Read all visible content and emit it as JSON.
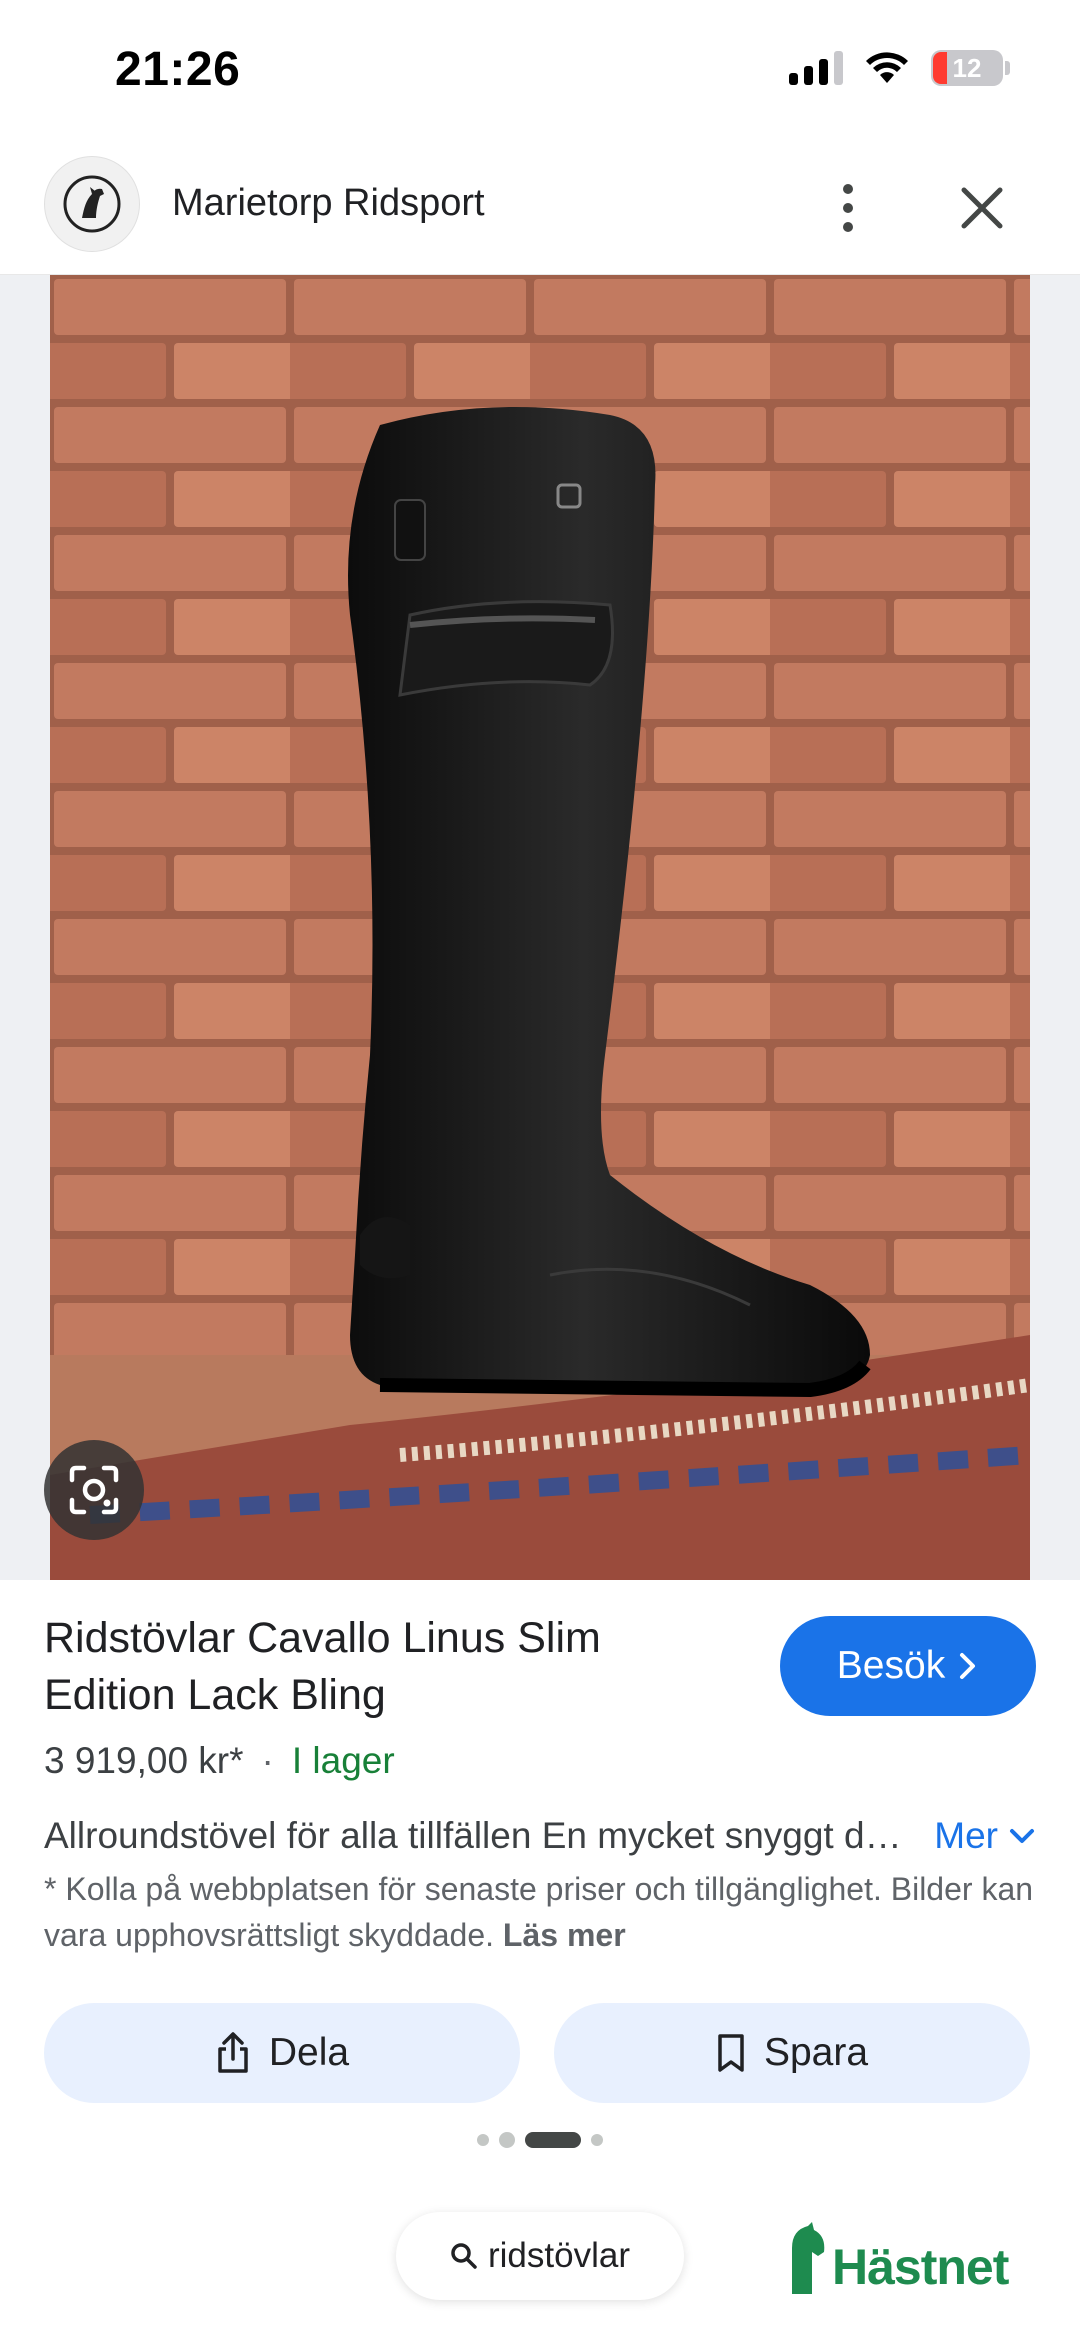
{
  "status_bar": {
    "time": "21:26",
    "battery": "12"
  },
  "header": {
    "site_name": "Marietorp Ridsport"
  },
  "product": {
    "title": "Ridstövlar Cavallo Linus Slim Edition Lack Bling",
    "visit_label": "Besök",
    "price": "3 919,00 kr*",
    "separator": "·",
    "stock": "I lager",
    "description": "Allroundstövel för alla tillfällen En mycket snyggt designad ridstövel",
    "more_label": "Mer",
    "disclaimer": "* Kolla på webbplatsen för senaste priser och tillgänglighet. Bilder kan vara upphovsrättsligt skyddade.",
    "read_more": "Läs mer"
  },
  "actions": {
    "share_label": "Dela",
    "save_label": "Spara"
  },
  "pager": {
    "total": 4,
    "active": 3
  },
  "bottom": {
    "search_query": "ridstövlar",
    "brand": "Hästnet"
  },
  "colors": {
    "accent": "#1a73e8",
    "stock_green": "#188038",
    "chip_bg": "#e8f0fe",
    "brand_green": "#1e8b4f"
  },
  "icons": [
    "horse-logo-icon",
    "more-vert-icon",
    "close-icon",
    "google-lens-icon",
    "chevron-right-icon",
    "chevron-down-icon",
    "share-icon",
    "bookmark-icon",
    "search-icon"
  ]
}
